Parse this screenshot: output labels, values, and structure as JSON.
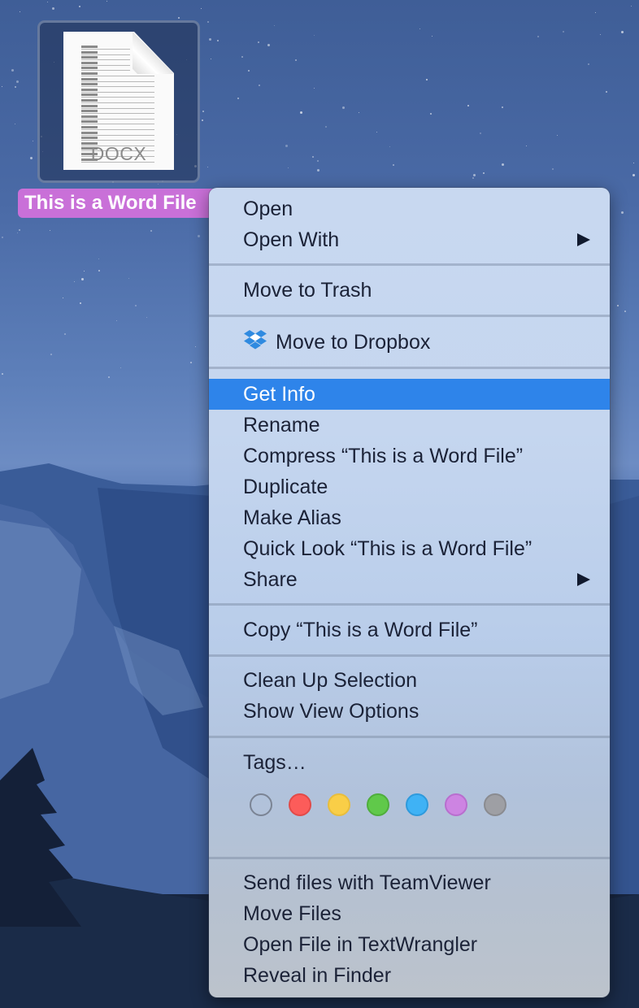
{
  "desktop": {
    "file": {
      "name": "This is a Word File",
      "extension": "DOCX",
      "icon": "docx-file-icon",
      "selected": true,
      "label_color": "#c970d8"
    }
  },
  "context_menu": {
    "highlight_color": "#2e84ea",
    "groups": [
      {
        "items": [
          {
            "label": "Open",
            "submenu": false
          },
          {
            "label": "Open With",
            "submenu": true
          }
        ]
      },
      {
        "items": [
          {
            "label": "Move to Trash",
            "submenu": false
          }
        ]
      },
      {
        "items": [
          {
            "label": "Move to Dropbox",
            "icon": "dropbox-icon",
            "submenu": false
          }
        ]
      },
      {
        "items": [
          {
            "label": "Get Info",
            "highlighted": true
          },
          {
            "label": "Rename"
          },
          {
            "label": "Compress “This is a Word File”"
          },
          {
            "label": "Duplicate"
          },
          {
            "label": "Make Alias"
          },
          {
            "label": "Quick Look “This is a Word File”"
          },
          {
            "label": "Share",
            "submenu": true
          }
        ]
      },
      {
        "items": [
          {
            "label": "Copy “This is a Word File”"
          }
        ]
      },
      {
        "items": [
          {
            "label": "Clean Up Selection"
          },
          {
            "label": "Show View Options"
          }
        ]
      },
      {
        "items": [
          {
            "label": "Tags…"
          }
        ],
        "tags": [
          {
            "name": "none",
            "color": "transparent",
            "border": "#7b8494"
          },
          {
            "name": "red",
            "color": "#fc5c5a",
            "border": "#e24a48"
          },
          {
            "name": "yellow",
            "color": "#f9ce47",
            "border": "#e8bd3c"
          },
          {
            "name": "green",
            "color": "#60c94a",
            "border": "#4fae3c"
          },
          {
            "name": "blue",
            "color": "#3fb2f5",
            "border": "#2e9adc"
          },
          {
            "name": "purple",
            "color": "#cd84e2",
            "border": "#b86ece"
          },
          {
            "name": "gray",
            "color": "#9e9fa4",
            "border": "#8a8b90"
          }
        ]
      },
      {
        "items": [
          {
            "label": "Send files with TeamViewer"
          },
          {
            "label": "Move Files"
          },
          {
            "label": "Open File in TextWrangler"
          },
          {
            "label": "Reveal in Finder"
          }
        ]
      }
    ]
  }
}
